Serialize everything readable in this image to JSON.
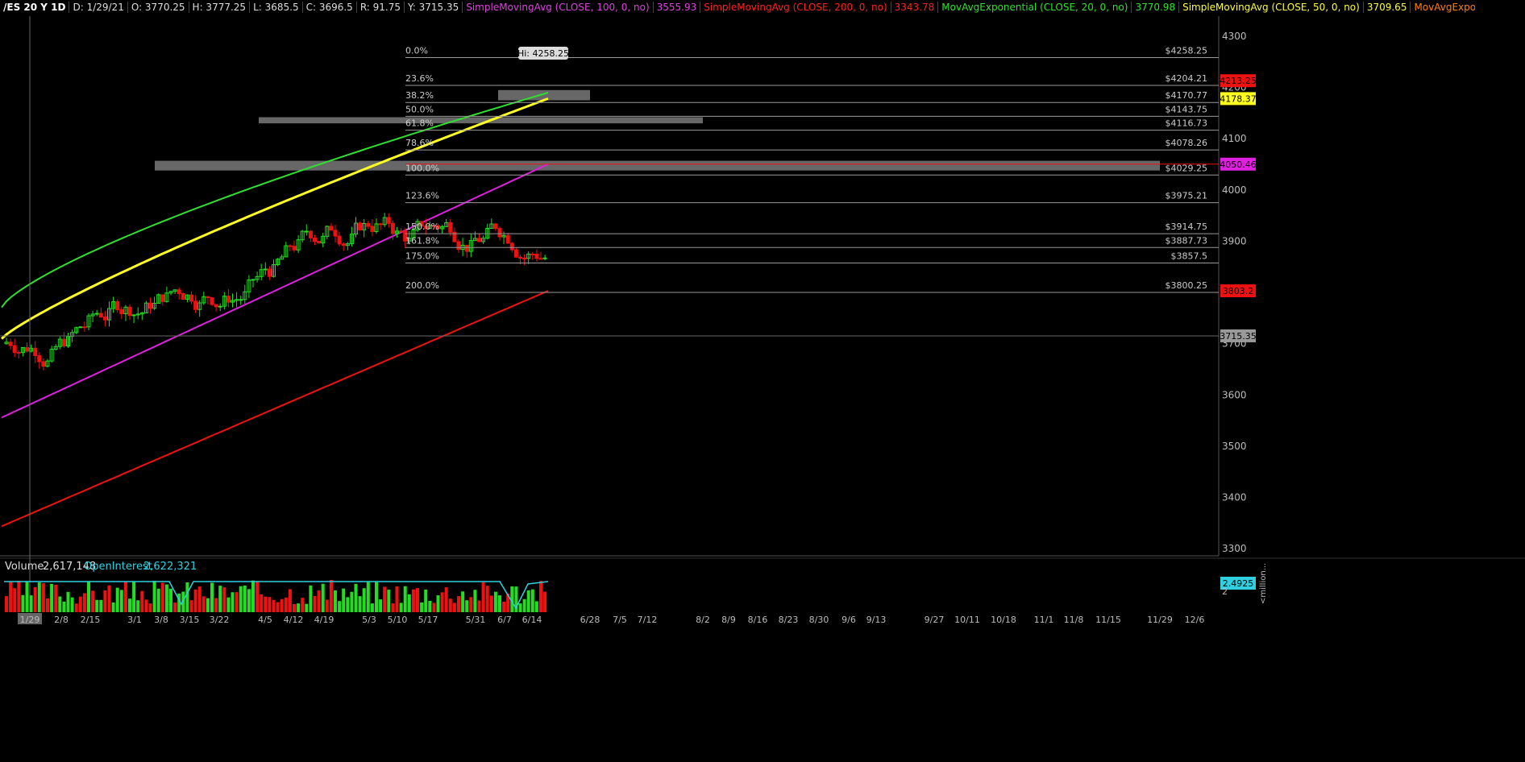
{
  "header": {
    "symbol": "/ES 20 Y 1D",
    "items": [
      {
        "text": "D: 1/29/21",
        "color": "#dddddd"
      },
      {
        "text": "O: 3770.25",
        "color": "#dddddd"
      },
      {
        "text": "H: 3777.25",
        "color": "#dddddd"
      },
      {
        "text": "L: 3685.5",
        "color": "#dddddd"
      },
      {
        "text": "C: 3696.5",
        "color": "#dddddd"
      },
      {
        "text": "R: 91.75",
        "color": "#dddddd"
      },
      {
        "text": "Y: 3715.35",
        "color": "#dddddd"
      },
      {
        "text": "SimpleMovingAvg (CLOSE, 100, 0, no)",
        "color": "#e040e0"
      },
      {
        "text": "3555.93",
        "color": "#e040e0"
      },
      {
        "text": "SimpleMovingAvg (CLOSE, 200, 0, no)",
        "color": "#ff2020"
      },
      {
        "text": "3343.78",
        "color": "#ff2020"
      },
      {
        "text": "MovAvgExponential (CLOSE, 20, 0, no)",
        "color": "#30e030"
      },
      {
        "text": "3770.98",
        "color": "#30e030"
      },
      {
        "text": "SimpleMovingAvg (CLOSE, 50, 0, no)",
        "color": "#ffff30"
      },
      {
        "text": "3709.65",
        "color": "#ffff30"
      },
      {
        "text": "MovAvgExponential ...",
        "color": "#ff7f00"
      }
    ]
  },
  "colors": {
    "up": "#22dd22",
    "down": "#ee1111",
    "ema20": "#30e030",
    "sma50": "#ffff20",
    "sma100": "#e020e0",
    "sma200": "#ee1111",
    "fib_line": "#9a9a9a",
    "zone": "#8a8a8a"
  },
  "chart_data": {
    "type": "candlestick",
    "title": "/ES 20 Y 1D",
    "ylim": [
      3250,
      4330
    ],
    "y_ticks": [
      "4300",
      "4200",
      "4100",
      "4000",
      "3900",
      "3800",
      "3700",
      "3600",
      "3500",
      "3400",
      "3300"
    ],
    "x_ticks": [
      "1/29",
      "2/8",
      "2/15",
      "3/1",
      "3/8",
      "3/15",
      "3/22",
      "4/5",
      "4/12",
      "4/19",
      "5/3",
      "5/10",
      "5/17",
      "5/31",
      "6/7",
      "6/14",
      "6/28",
      "7/5",
      "7/12",
      "8/2",
      "8/9",
      "8/16",
      "8/23",
      "8/30",
      "9/6",
      "9/13",
      "9/27",
      "10/11",
      "10/18",
      "11/1",
      "11/8",
      "11/15",
      "11/29",
      "12/6"
    ],
    "fib_levels": [
      {
        "pct": "0.0%",
        "price": 4258.25,
        "label": "$4258.25"
      },
      {
        "pct": "23.6%",
        "price": 4204.21,
        "label": "$4204.21"
      },
      {
        "pct": "38.2%",
        "price": 4170.77,
        "label": "$4170.77"
      },
      {
        "pct": "50.0%",
        "price": 4143.75,
        "label": "$4143.75"
      },
      {
        "pct": "61.8%",
        "price": 4116.73,
        "label": "$4116.73"
      },
      {
        "pct": "78.6%",
        "price": 4078.26,
        "label": "$4078.26"
      },
      {
        "pct": "100.0%",
        "price": 4029.25,
        "label": "$4029.25"
      },
      {
        "pct": "123.6%",
        "price": 3975.21,
        "label": "$3975.21"
      },
      {
        "pct": "150.0%",
        "price": 3914.75,
        "label": "$3914.75"
      },
      {
        "pct": "161.8%",
        "price": 3887.73,
        "label": "$3887.73"
      },
      {
        "pct": "175.0%",
        "price": 3857.5,
        "label": "$3857.5"
      },
      {
        "pct": "200.0%",
        "price": 3800.25,
        "label": "$3800.25"
      }
    ],
    "hi_label": "Hi: 4258.25",
    "price_badges": [
      {
        "value": "4213.25",
        "price": 4213.25,
        "bg": "#ee1111",
        "fg": "#000000"
      },
      {
        "value": "4178.37",
        "price": 4178.37,
        "bg": "#ffff20",
        "fg": "#000000"
      },
      {
        "value": "4050.46",
        "price": 4050.46,
        "bg": "#e020e0",
        "fg": "#000000"
      },
      {
        "value": "3803.2",
        "price": 3803.2,
        "bg": "#ee1111",
        "fg": "#000000"
      },
      {
        "value": "3715.35",
        "price": 3715.35,
        "bg": "#999999",
        "fg": "#000000"
      }
    ],
    "zones": [
      {
        "from": 4038,
        "to": 4057,
        "start": "3/8",
        "end": "11/29"
      },
      {
        "from": 4130,
        "to": 4142,
        "start": "4/5",
        "end": "8/2"
      },
      {
        "from": 4175,
        "to": 4195,
        "start": "6/7",
        "end": "6/28"
      }
    ],
    "hline_price": 4050.46,
    "crosshair": {
      "date": "1/29",
      "price": 3715.35
    },
    "series": [
      {
        "name": "SimpleMovingAvg (CLOSE, 200, 0, no)",
        "type": "sma200",
        "from": 3343.78,
        "to": 3803.2
      },
      {
        "name": "SimpleMovingAvg (CLOSE, 100, 0, no)",
        "type": "sma100",
        "from": 3555.93,
        "to": 4050.46
      },
      {
        "name": "SimpleMovingAvg (CLOSE, 50, 0, no)",
        "type": "sma50",
        "from": 3709.65,
        "to": 4178.37
      },
      {
        "name": "MovAvgExponential (CLOSE, 20, 0, no)",
        "type": "ema20",
        "from": 3770.98,
        "to": 4190
      }
    ],
    "volume": {
      "label": "Volume",
      "value": "2,617,148",
      "oi_label": "OpenInterest",
      "oi_value": "2,622,321",
      "badge": "2.4925",
      "unit_label": "<million...",
      "tick_2": "2"
    }
  }
}
